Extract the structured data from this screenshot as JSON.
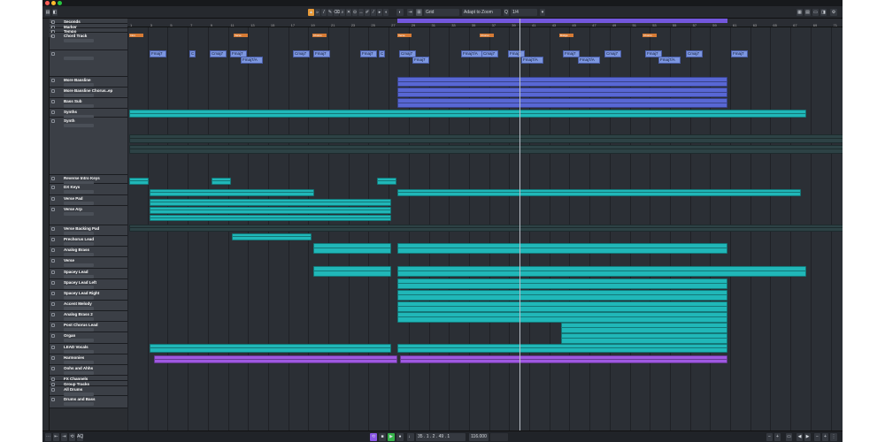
{
  "window": {
    "title_left_icons": [
      "close",
      "minimize",
      "zoom"
    ]
  },
  "toolbar": {
    "snap_mode": "Grid",
    "snap_type": "Adapt to Zoom",
    "quantize": "1/4",
    "left_label": "",
    "right_label": ""
  },
  "ruler": {
    "labels": [
      "1",
      "3",
      "5",
      "7",
      "9",
      "11",
      "13",
      "15",
      "17",
      "19",
      "21",
      "23",
      "25",
      "27",
      "29",
      "31",
      "33",
      "35",
      "37",
      "39",
      "41",
      "43",
      "45",
      "47",
      "49",
      "51",
      "53",
      "55",
      "57",
      "59",
      "61",
      "63",
      "65",
      "67",
      "69",
      "71",
      "73",
      "75",
      "77",
      "79",
      "81"
    ]
  },
  "markers": [
    "Intro",
    "Verse",
    "Chorus",
    "Verse",
    "Chorus",
    "Bridge",
    "Chorus"
  ],
  "chords": [
    "Fmaj7",
    "C",
    "Cmaj7",
    "Fmaj7",
    "Fmaj7/A",
    "Cmaj7",
    "Fmaj7",
    "Fmaj7",
    "C",
    "Cmaj7",
    "Fmaj7",
    "Fmaj7/A",
    "Cmaj7",
    "Fmaj7",
    "Fmaj7/A",
    "Fmaj7",
    "Fmaj7/A",
    "Cmaj7",
    "Fmaj7",
    "Fmaj7/A",
    "Cmaj7",
    "Fmaj7"
  ],
  "tracks": [
    {
      "num": "1",
      "name": "Seconds"
    },
    {
      "num": "2",
      "name": "Marker"
    },
    {
      "num": "3",
      "name": "Tempo"
    },
    {
      "num": "4",
      "name": "Chord Track"
    },
    {
      "num": "",
      "name": ""
    },
    {
      "num": "",
      "name": "More Bassline"
    },
    {
      "num": "",
      "name": "More Bassline Chorus..ep"
    },
    {
      "num": "",
      "name": "Bass Sub"
    },
    {
      "num": "",
      "name": "Synths"
    },
    {
      "num": "",
      "name": "Synth"
    },
    {
      "num": "",
      "name": "Reverse Intro Keys"
    },
    {
      "num": "",
      "name": "DX Keys"
    },
    {
      "num": "",
      "name": "Verse Pad"
    },
    {
      "num": "",
      "name": "Verse Arp"
    },
    {
      "num": "",
      "name": "Verse Backing Pad"
    },
    {
      "num": "",
      "name": "Prechorus Lead"
    },
    {
      "num": "",
      "name": "Analog Brass"
    },
    {
      "num": "",
      "name": "Verse"
    },
    {
      "num": "",
      "name": "Spacey Lead"
    },
    {
      "num": "",
      "name": "Spacey Lead Left"
    },
    {
      "num": "",
      "name": "Spacey Lead Right"
    },
    {
      "num": "",
      "name": "Accent Melody"
    },
    {
      "num": "",
      "name": "Analog Brass 2"
    },
    {
      "num": "",
      "name": "Post Chorus Lead"
    },
    {
      "num": "",
      "name": "Organ"
    },
    {
      "num": "",
      "name": "LEAD Vocals"
    },
    {
      "num": "",
      "name": "Harmonies"
    },
    {
      "num": "",
      "name": "Oohs and Ahhs"
    },
    {
      "num": "",
      "name": "FX Channels"
    },
    {
      "num": "",
      "name": "Group Tracks"
    },
    {
      "num": "",
      "name": "All Drums"
    },
    {
      "num": "",
      "name": "Drums and Bass"
    }
  ],
  "transport": {
    "position": "35 . 1 . 2 . 49 . 1",
    "tempo": "116.000",
    "signature": ""
  },
  "colors": {
    "cyan": "#20b7b8",
    "blue": "#5867d4",
    "purple": "#9e58e0",
    "loop": "#7b5cf0",
    "marker": "#d67b35"
  }
}
